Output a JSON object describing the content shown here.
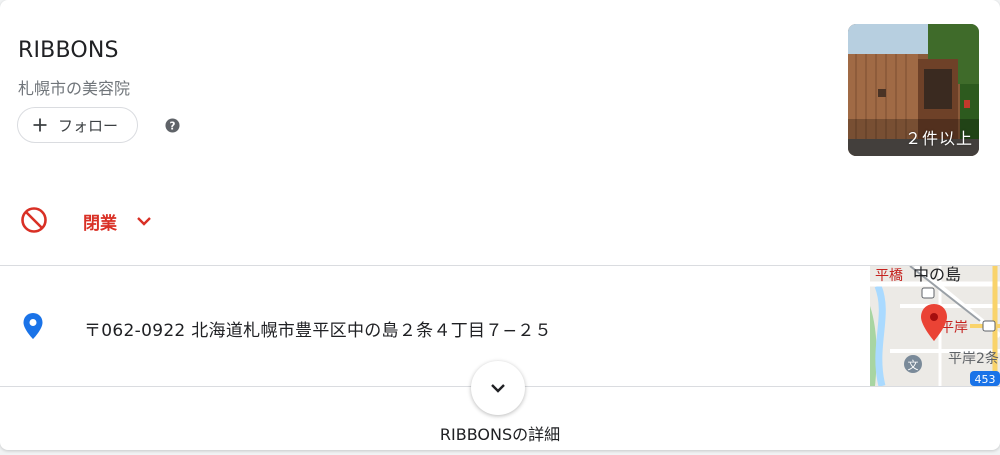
{
  "place": {
    "name": "RIBBONS",
    "category": "札幌市の美容院"
  },
  "actions": {
    "follow_label": "フォロー"
  },
  "photo": {
    "count_label": "２件以上"
  },
  "status": {
    "text": "閉業",
    "color": "#d93025"
  },
  "address": {
    "text": "〒062-0922 北海道札幌市豊平区中の島２条４丁目７−２５"
  },
  "map": {
    "label_top": "中の島",
    "label_left": "平橋",
    "label_mid": "平岸",
    "label_bottom": "平岸2条",
    "route_badge": "453"
  },
  "footer": {
    "details_label": "RIBBONSの詳細"
  },
  "icons": {
    "add": "plus-icon",
    "help": "help-icon",
    "closed": "prohibited-icon",
    "expand_status": "chevron-down-icon",
    "address": "location-pin-icon",
    "expand_details": "chevron-down-icon"
  }
}
